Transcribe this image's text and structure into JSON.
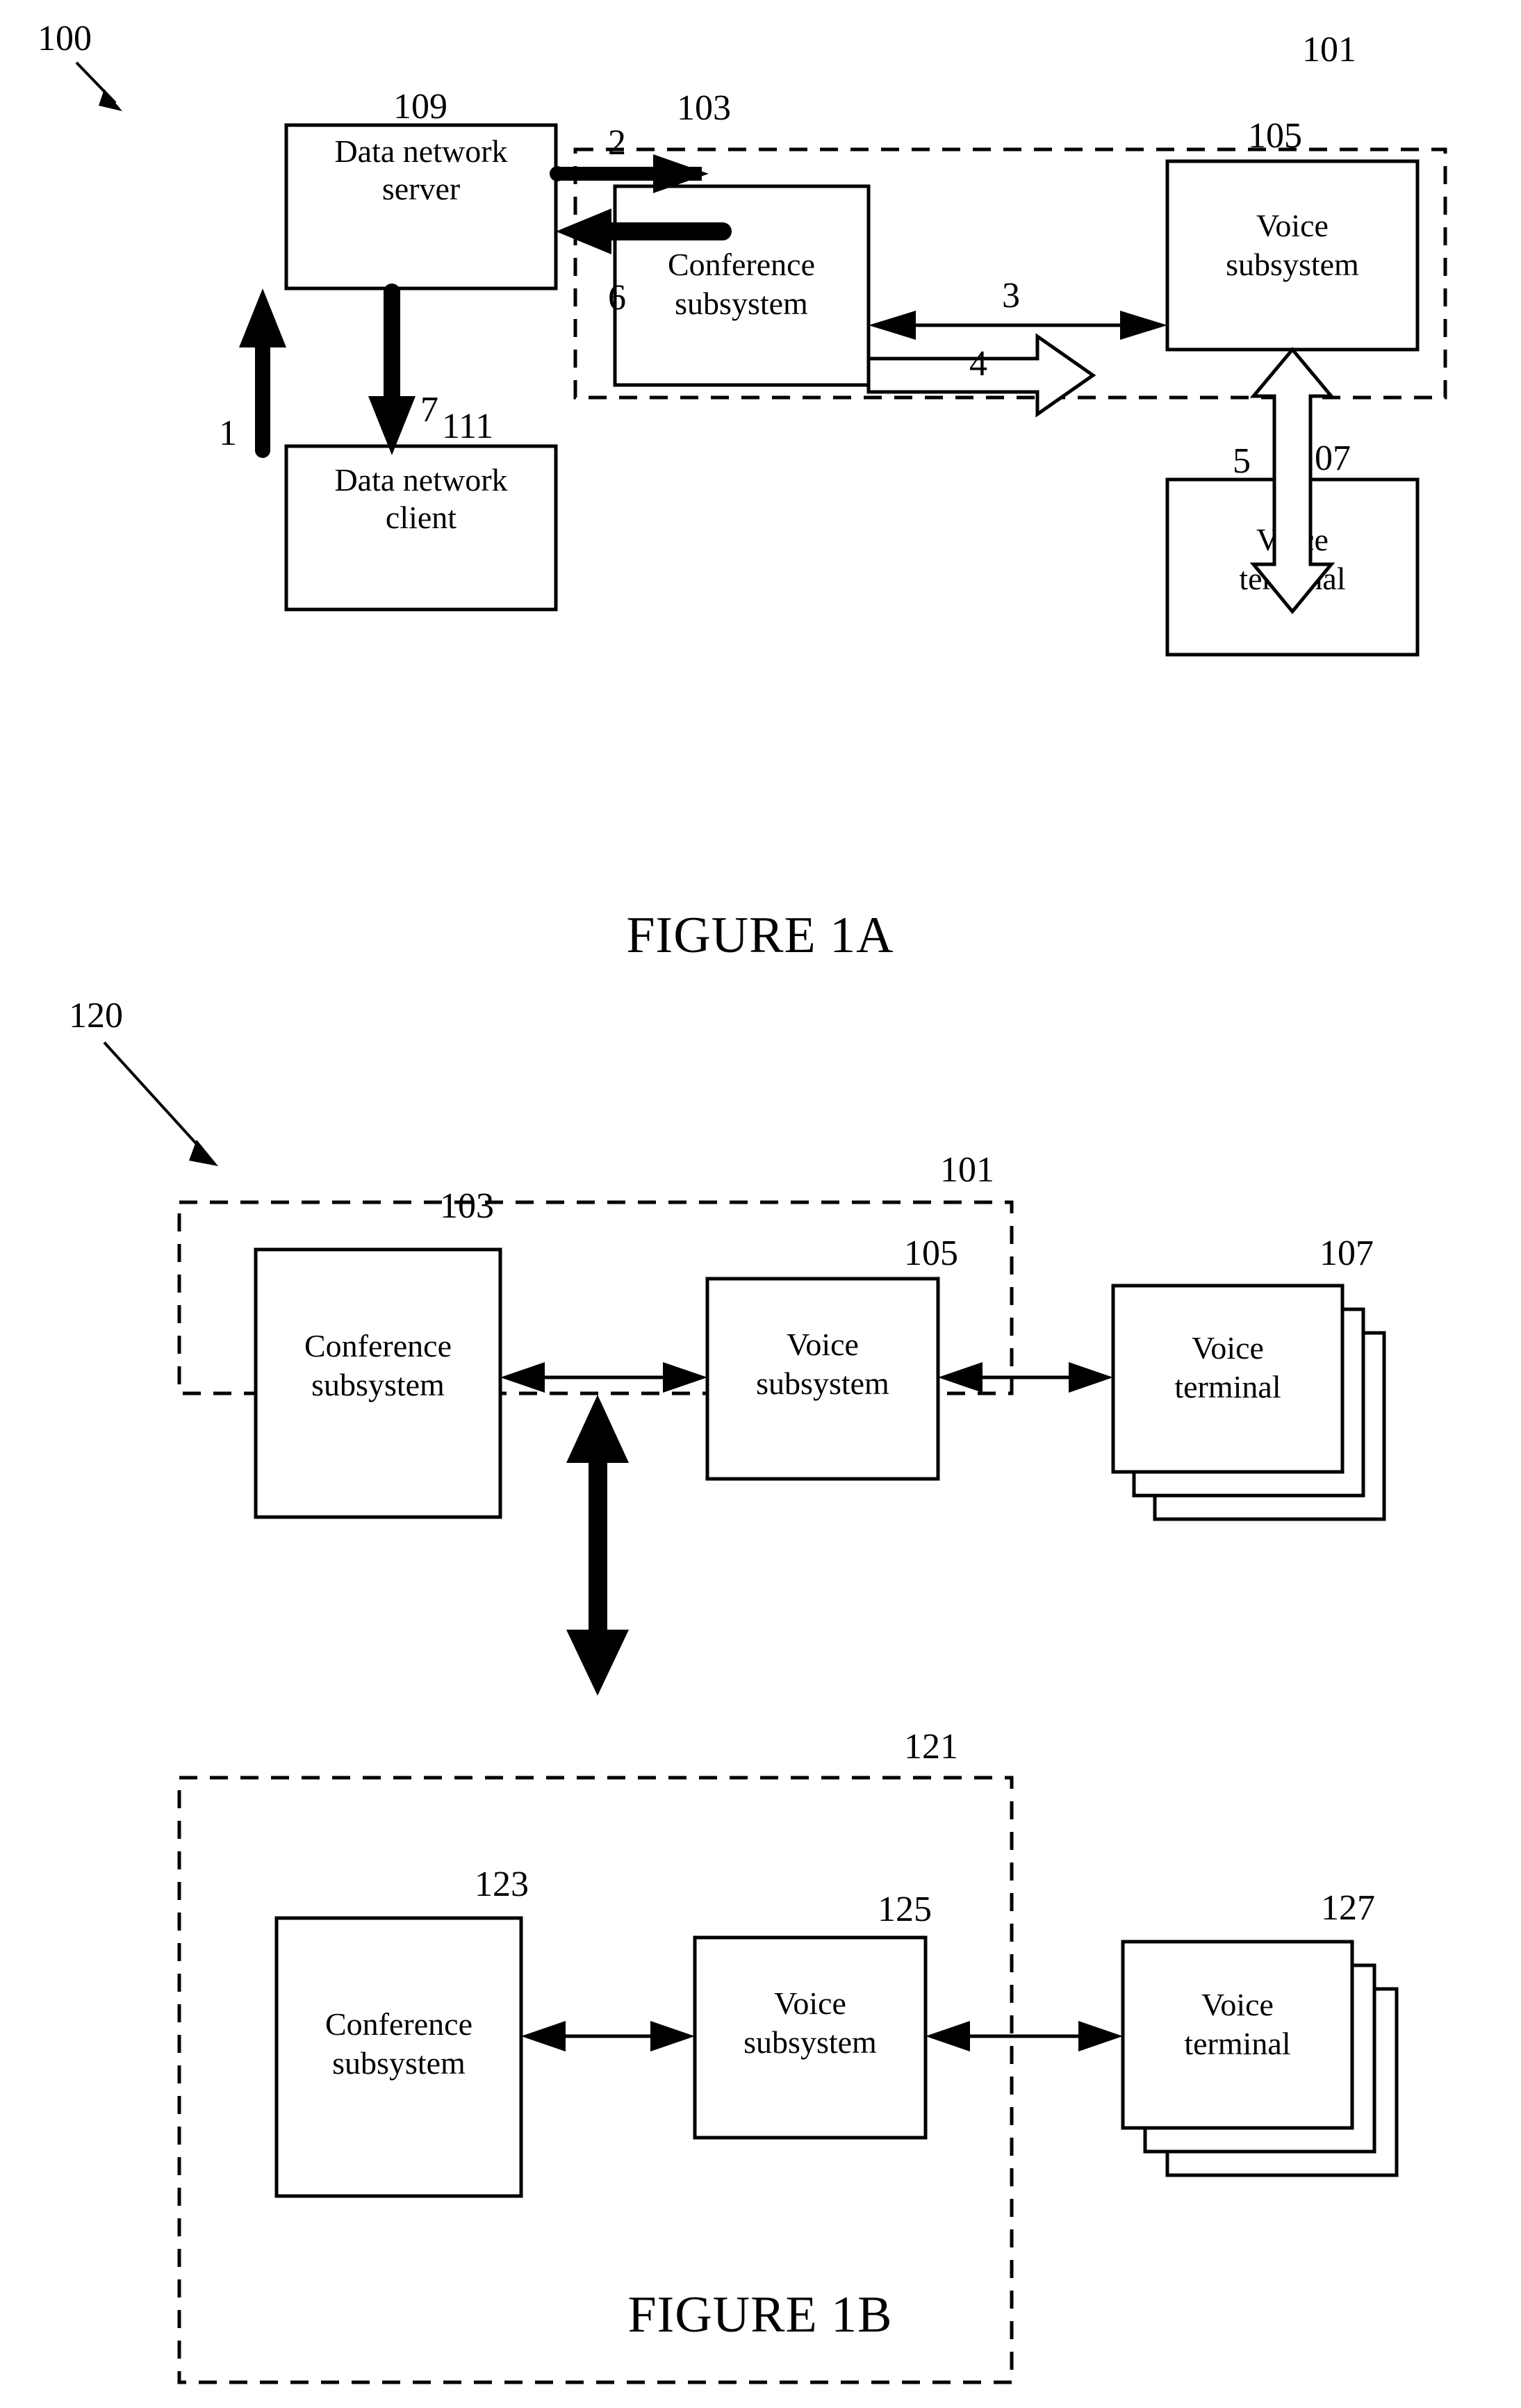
{
  "document": {
    "type": "patent-figure-sheet",
    "figures": [
      {
        "id": "fig-1a",
        "caption": "FIGURE 1A",
        "system_ref": "100",
        "container_ref": "101",
        "boxes": [
          {
            "ref": "109",
            "line1": "Data network",
            "line2": "server"
          },
          {
            "ref": "111",
            "line1": "Data network",
            "line2": "client"
          },
          {
            "ref": "103",
            "line1": "Conference",
            "line2": "subsystem"
          },
          {
            "ref": "105",
            "line1": "Voice",
            "line2": "subsystem"
          },
          {
            "ref": "107",
            "line1": "Voice",
            "line2": "terminal"
          }
        ],
        "flows": [
          {
            "num": "1",
            "from": "111",
            "to": "109",
            "style": "thick-solid",
            "direction": "up"
          },
          {
            "num": "2",
            "from": "109",
            "to": "103",
            "style": "thick-solid",
            "direction": "right"
          },
          {
            "num": "3",
            "from": "103",
            "to": "105",
            "style": "thin-double",
            "direction": "both"
          },
          {
            "num": "4",
            "from": "103",
            "to": "105",
            "style": "hollow-block",
            "direction": "right"
          },
          {
            "num": "5",
            "from": "105",
            "to": "107",
            "style": "hollow-block-double",
            "direction": "both"
          },
          {
            "num": "6",
            "from": "103",
            "to": "109",
            "style": "thick-solid",
            "direction": "left"
          },
          {
            "num": "7",
            "from": "109",
            "to": "111",
            "style": "thick-solid",
            "direction": "down"
          }
        ]
      },
      {
        "id": "fig-1b",
        "caption": "FIGURE 1B",
        "system_ref": "120",
        "containers": [
          {
            "ref": "101"
          },
          {
            "ref": "121"
          }
        ],
        "boxes": [
          {
            "ref": "103",
            "line1": "Conference",
            "line2": "subsystem"
          },
          {
            "ref": "105",
            "line1": "Voice",
            "line2": "subsystem"
          },
          {
            "ref": "107",
            "line1": "Voice",
            "line2": "terminal",
            "stacked": true
          },
          {
            "ref": "123",
            "line1": "Conference",
            "line2": "subsystem"
          },
          {
            "ref": "125",
            "line1": "Voice",
            "line2": "subsystem"
          },
          {
            "ref": "127",
            "line1": "Voice",
            "line2": "terminal",
            "stacked": true
          }
        ],
        "flows": [
          {
            "from": "103",
            "to": "105",
            "style": "thin-double",
            "direction": "both"
          },
          {
            "from": "105",
            "to": "107",
            "style": "thin-double",
            "direction": "both"
          },
          {
            "from": "101",
            "to": "121",
            "style": "thick-solid-double",
            "direction": "both"
          },
          {
            "from": "123",
            "to": "125",
            "style": "thin-double",
            "direction": "both"
          },
          {
            "from": "125",
            "to": "127",
            "style": "thin-double",
            "direction": "both"
          }
        ]
      }
    ]
  },
  "labels": {
    "data_network_server_l1": "Data network",
    "data_network_server_l2": "server",
    "data_network_client_l1": "Data network",
    "data_network_client_l2": "client",
    "conference_l1": "Conference",
    "conference_l2": "subsystem",
    "voice_sub_l1": "Voice",
    "voice_sub_l2": "subsystem",
    "voice_term_l1": "Voice",
    "voice_term_l2": "terminal"
  },
  "refs": {
    "r100": "100",
    "r101": "101",
    "r103": "103",
    "r105": "105",
    "r107": "107",
    "r109": "109",
    "r111": "111",
    "r120": "120",
    "r121": "121",
    "r123": "123",
    "r125": "125",
    "r127": "127"
  },
  "flownums": {
    "n1": "1",
    "n2": "2",
    "n3": "3",
    "n4": "4",
    "n5": "5",
    "n6": "6",
    "n7": "7"
  },
  "captions": {
    "fig1a": "FIGURE 1A",
    "fig1b": "FIGURE 1B"
  },
  "colors": {
    "ink": "#000000",
    "paper": "#ffffff"
  }
}
